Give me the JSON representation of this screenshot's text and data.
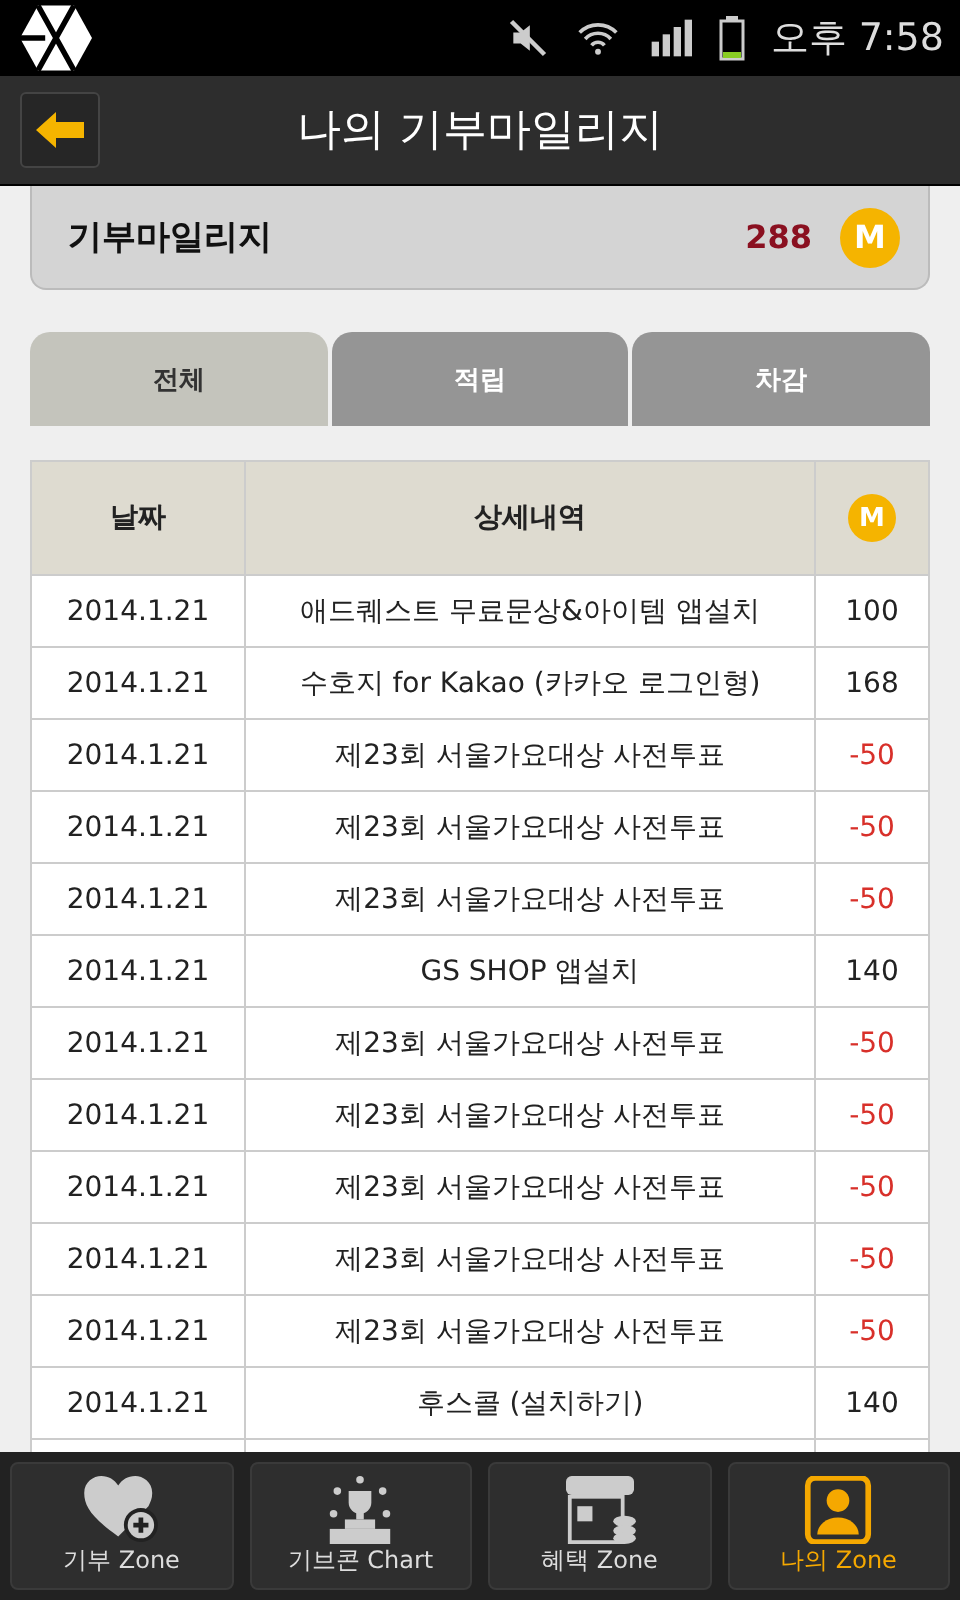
{
  "status_bar": {
    "time": "오후 7:58"
  },
  "header": {
    "title": "나의 기부마일리지"
  },
  "summary": {
    "label": "기부마일리지",
    "value": "288",
    "coin": "M"
  },
  "tabs": [
    {
      "label": "전체",
      "selected": true
    },
    {
      "label": "적립",
      "selected": false
    },
    {
      "label": "차감",
      "selected": false
    }
  ],
  "table": {
    "columns": [
      "날짜",
      "상세내역",
      "M"
    ],
    "rows": [
      {
        "date": "2014.1.21",
        "detail": "애드퀘스트 무료문상&아이템 앱설치",
        "amount": "100",
        "kind": "earn"
      },
      {
        "date": "2014.1.21",
        "detail": "수호지 for Kakao (카카오 로그인형)",
        "amount": "168",
        "kind": "earn"
      },
      {
        "date": "2014.1.21",
        "detail": "제23회 서울가요대상 사전투표",
        "amount": "-50",
        "kind": "deduct"
      },
      {
        "date": "2014.1.21",
        "detail": "제23회 서울가요대상 사전투표",
        "amount": "-50",
        "kind": "deduct"
      },
      {
        "date": "2014.1.21",
        "detail": "제23회 서울가요대상 사전투표",
        "amount": "-50",
        "kind": "deduct"
      },
      {
        "date": "2014.1.21",
        "detail": "GS SHOP 앱설치",
        "amount": "140",
        "kind": "earn"
      },
      {
        "date": "2014.1.21",
        "detail": "제23회 서울가요대상 사전투표",
        "amount": "-50",
        "kind": "deduct"
      },
      {
        "date": "2014.1.21",
        "detail": "제23회 서울가요대상 사전투표",
        "amount": "-50",
        "kind": "deduct"
      },
      {
        "date": "2014.1.21",
        "detail": "제23회 서울가요대상 사전투표",
        "amount": "-50",
        "kind": "deduct"
      },
      {
        "date": "2014.1.21",
        "detail": "제23회 서울가요대상 사전투표",
        "amount": "-50",
        "kind": "deduct"
      },
      {
        "date": "2014.1.21",
        "detail": "제23회 서울가요대상 사전투표",
        "amount": "-50",
        "kind": "deduct"
      },
      {
        "date": "2014.1.21",
        "detail": "후스콜 (설치하기)",
        "amount": "140",
        "kind": "earn"
      }
    ]
  },
  "bottom_nav": [
    {
      "label": "기부 Zone",
      "selected": false
    },
    {
      "label": "기브콘 Chart",
      "selected": false
    },
    {
      "label": "혜택 Zone",
      "selected": false
    },
    {
      "label": "나의 Zone",
      "selected": true
    }
  ]
}
